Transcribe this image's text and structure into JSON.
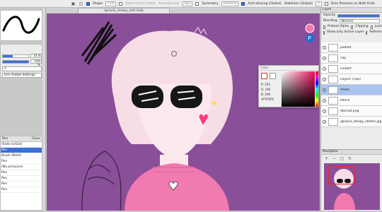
{
  "toolbar": {
    "shape_label": "Shape",
    "shape_value": "Line",
    "select_center_label": "Select From Center",
    "round_corner_label": "RoundCorner",
    "round_corner_value": "8px",
    "symmetry_label": "Symmetry",
    "symmetry_value": "Bilateral",
    "antialias_label": "Anti-aliasing (Global)",
    "stabilizer_label": "Stabilizer (Global)",
    "stabilizer_value": "3",
    "zero_pressure_label": "Zero Pressure on Both Ends"
  },
  "document": {
    "title": "ignacio_sleepy_edit.mdp"
  },
  "brush": {
    "size_value": "14.8",
    "opacity_value": "100 %",
    "stabilizer_value": "2",
    "global_settings_label": "Use Global Settings"
  },
  "brush_list": {
    "header_left": "Pen",
    "header_right": "Close",
    "items": [
      "(Fade In/Out)",
      "Pen",
      "Brush (Bold)",
      "Pen",
      "(No pressure)",
      "Pen",
      "Pen",
      "Pen",
      "Pen"
    ],
    "active_index": 1
  },
  "color_window": {
    "title": "Color",
    "r_label": "R: 255",
    "g_label": "G: 246",
    "b_label": "B: 249",
    "hex": "#FFF6F9"
  },
  "layer_panel": {
    "title": "Layer",
    "opacity_label": "Opacity",
    "blending_label": "Blending",
    "blending_value": "Normal",
    "protect_alpha_label": "Protect Alpha",
    "clipping_label": "Clipping",
    "show_only_active_label": "Show only Active Layer",
    "reference_label": "Reference",
    "lock_label": "Lock",
    "layers": [
      {
        "name": "pollute",
        "active": false
      },
      {
        "name": "clip",
        "active": false
      },
      {
        "name": "Lineart",
        "active": false
      },
      {
        "name": "Layer1 (Clip)",
        "active": false
      },
      {
        "name": "Photo",
        "active": true
      },
      {
        "name": "Pencil",
        "active": false
      },
      {
        "name": "decrasf.png",
        "active": false
      },
      {
        "name": "ignacio_sleepy_sketch.jpg",
        "active": false
      }
    ]
  },
  "navigator": {
    "title": "Navigator"
  },
  "colors": {
    "canvas_bg": "#8a4f99",
    "accent": "#3a6fd8",
    "active_layer": "#a9c4ee"
  }
}
